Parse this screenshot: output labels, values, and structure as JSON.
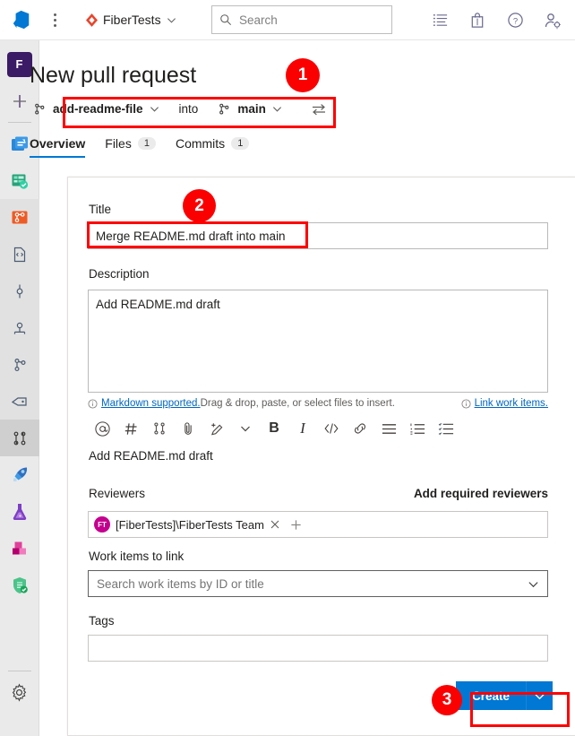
{
  "header": {
    "logo_icon": "azure-devops-logo-icon",
    "more_icon": "more-vertical-icon",
    "project_name": "FiberTests",
    "project_icon": "project-diamond-icon",
    "project_chevron": "chevron-down-icon",
    "search": {
      "placeholder": "Search",
      "icon": "search-icon"
    },
    "icons": [
      {
        "name": "work-items-icon"
      },
      {
        "name": "marketplace-bag-icon"
      },
      {
        "name": "help-circle-icon"
      },
      {
        "name": "user-settings-icon"
      }
    ]
  },
  "rail": {
    "avatar_initial": "F",
    "items": [
      {
        "name": "new-item",
        "icon": "plus-icon"
      },
      {
        "name": "overview",
        "icon": "overview-icon"
      },
      {
        "name": "boards",
        "icon": "boards-icon"
      },
      {
        "name": "repos",
        "icon": "repos-icon"
      },
      {
        "name": "files",
        "icon": "files-icon"
      },
      {
        "name": "commits",
        "icon": "commits-icon"
      },
      {
        "name": "pushes",
        "icon": "pushes-icon"
      },
      {
        "name": "branches",
        "icon": "branches-icon"
      },
      {
        "name": "tags",
        "icon": "tags-icon"
      },
      {
        "name": "pull-requests",
        "icon": "pull-request-icon"
      },
      {
        "name": "pipelines",
        "icon": "pipelines-rocket-icon"
      },
      {
        "name": "test-plans",
        "icon": "test-plans-flask-icon"
      },
      {
        "name": "artifacts",
        "icon": "artifacts-boxes-icon"
      },
      {
        "name": "advanced-security",
        "icon": "shield-check-icon"
      },
      {
        "name": "project-settings",
        "icon": "gear-icon"
      }
    ]
  },
  "page": {
    "title": "New pull request",
    "source_branch": "add-readme-file",
    "into_word": "into",
    "target_branch": "main",
    "branch_icon": "branch-icon",
    "chevron": "chevron-down-icon",
    "swap_icon": "swap-branches-icon"
  },
  "tabs": [
    {
      "label": "Overview",
      "count": "",
      "active": true
    },
    {
      "label": "Files",
      "count": "1",
      "active": false
    },
    {
      "label": "Commits",
      "count": "1",
      "active": false
    }
  ],
  "form": {
    "title_label": "Title",
    "title_value": "Merge README.md draft into main",
    "description_label": "Description",
    "description_value": "Add README.md draft",
    "markdown_info_icon": "info-icon",
    "markdown_link": "Markdown supported.",
    "markdown_hint": " Drag & drop, paste, or select files to insert.",
    "link_work_items_icon": "info-icon",
    "link_work_items": "Link work items.",
    "toolbar_buttons": [
      {
        "name": "mention-icon",
        "glyph": "@"
      },
      {
        "name": "heading-hash-icon",
        "glyph": "#"
      },
      {
        "name": "pull-request-link-icon",
        "glyph": ""
      },
      {
        "name": "attach-file-icon",
        "glyph": ""
      },
      {
        "name": "highlight-pen-icon",
        "glyph": ""
      },
      {
        "name": "highlight-chevron-icon",
        "glyph": ""
      },
      {
        "name": "bold-icon",
        "glyph": "B"
      },
      {
        "name": "italic-icon",
        "glyph": "I"
      },
      {
        "name": "code-icon",
        "glyph": ""
      },
      {
        "name": "insert-link-icon",
        "glyph": ""
      },
      {
        "name": "bulleted-list-icon",
        "glyph": ""
      },
      {
        "name": "numbered-list-icon",
        "glyph": ""
      },
      {
        "name": "task-list-icon",
        "glyph": ""
      }
    ],
    "preview_text": "Add README.md draft",
    "reviewers_label": "Reviewers",
    "add_required_reviewers": "Add required reviewers",
    "reviewer": {
      "avatar_initials": "FT",
      "avatar_color": "#c4018f",
      "name": "[FiberTests]\\FiberTests Team",
      "remove_icon": "close-icon",
      "add_icon": "plus-icon"
    },
    "work_items_label": "Work items to link",
    "work_items_placeholder": "Search work items by ID or title",
    "work_items_chevron": "chevron-down-icon",
    "tags_label": "Tags",
    "tags_value": "",
    "create_label": "Create",
    "create_chevron": "chevron-down-icon",
    "create_color": "#0078d4"
  },
  "annotations": {
    "color": "#fa0000",
    "badges": [
      {
        "label": "1"
      },
      {
        "label": "2"
      },
      {
        "label": "3"
      }
    ]
  }
}
